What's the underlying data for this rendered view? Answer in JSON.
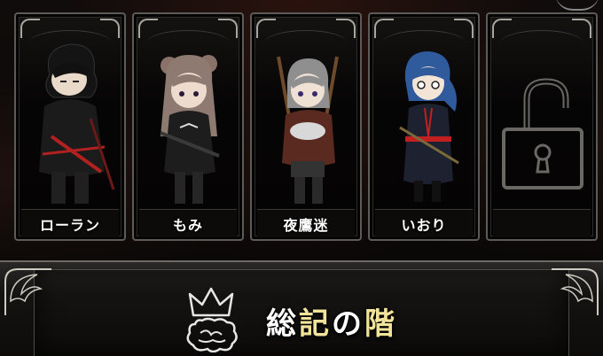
{
  "characters": [
    {
      "name": "ローラン",
      "locked": false
    },
    {
      "name": "もみ",
      "locked": false
    },
    {
      "name": "夜鷹迷",
      "locked": false
    },
    {
      "name": "いおり",
      "locked": false
    },
    {
      "name": "",
      "locked": true
    }
  ],
  "banner": {
    "title_parts": [
      "総",
      "記",
      "の",
      "階"
    ]
  },
  "colors": {
    "title_white": "#ffffff",
    "title_gold": "#f1e49a",
    "frame": "#5d5b58"
  }
}
